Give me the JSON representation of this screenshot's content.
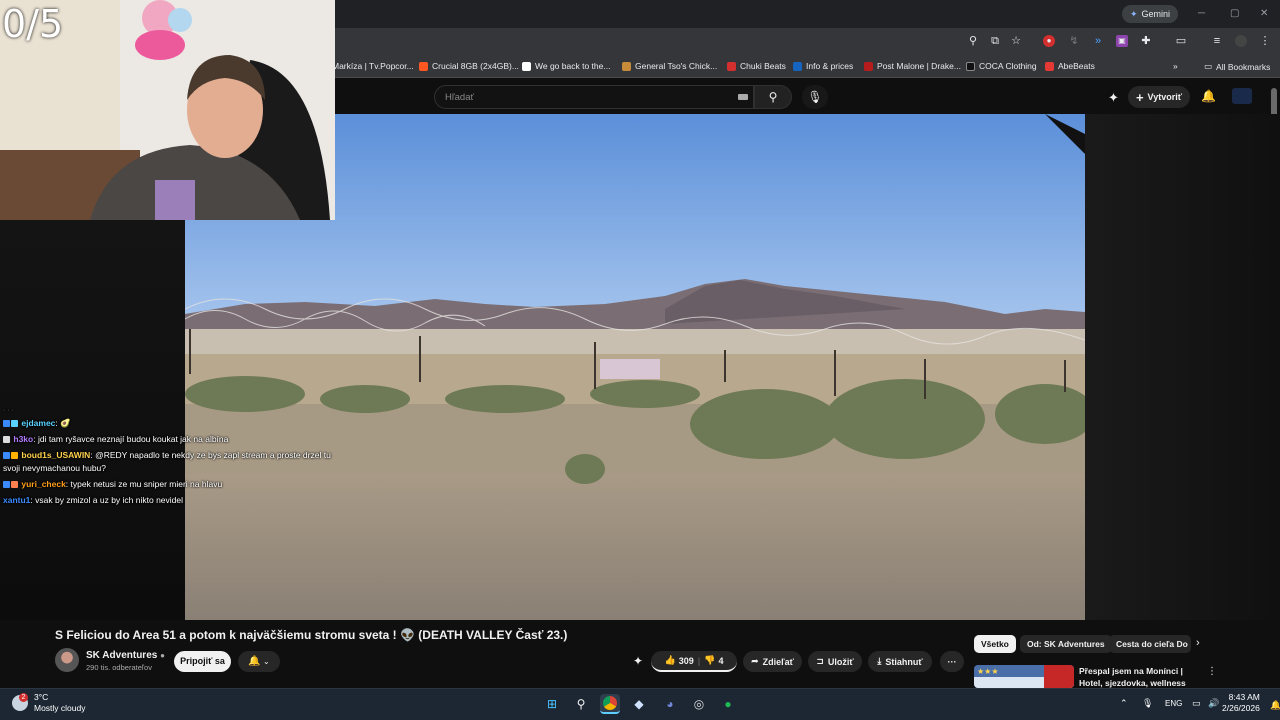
{
  "stream_overlay": {
    "score": "0/5"
  },
  "browser": {
    "gemini_label": "Gemini",
    "bookmarks": [
      {
        "label": "Markíza | Tv.Popcor...",
        "color": "#e53935"
      },
      {
        "label": "Crucial 8GB (2x4GB)...",
        "color": "#ff5722"
      },
      {
        "label": "We go back to the...",
        "color": "#ffffff"
      },
      {
        "label": "General Tso's Chick...",
        "color": "#c78b3a"
      },
      {
        "label": "Chuki Beats",
        "color": "#d32f2f"
      },
      {
        "label": "Info & prices",
        "color": "#1565c0"
      },
      {
        "label": "Post Malone | Drake...",
        "color": "#b71c1c"
      },
      {
        "label": "COCA Clothing",
        "color": "#111111"
      },
      {
        "label": "AbeBeats",
        "color": "#e53935"
      }
    ],
    "all_bookmarks": "All Bookmarks"
  },
  "youtube": {
    "search_placeholder": "Hľadať",
    "create_label": "Vytvoriť",
    "video_title": "S Feliciou do Area 51 a potom k najväčšiemu stromu sveta ! 👽 (DEATH VALLEY Časť 23.)",
    "channel_name": "SK Adventures",
    "subscribers": "290 tis. odberateľov",
    "join_label": "Pripojiť sa",
    "likes": "309",
    "dislikes": "4",
    "share_label": "Zdieľať",
    "save_label": "Uložiť",
    "download_label": "Stiahnuť",
    "chips": [
      "Všetko",
      "Od: SK Adventures",
      "Cesta do cieľa Do"
    ],
    "recommended_title": "Přespal jsem na Monínci | Hotel, sjezdovka, wellness"
  },
  "chat": [
    {
      "user": "ejdamec",
      "text": "🥑",
      "color": "#5ad1ff"
    },
    {
      "user": "h3ko",
      "text": "jdi tam ryšavce neznají budou koukat jak na albína",
      "color": "#b07cff"
    },
    {
      "user": "boud1s_USAWIN",
      "text": "@REDY napadlo te nekdy ze bys zapl stream a proste drzel tu svoji nevymachanou hubu?",
      "color": "#ffd24d"
    },
    {
      "user": "yuri_check",
      "text": "typek netusi ze mu sniper mieri na hlavu",
      "color": "#ff9f1a"
    },
    {
      "user": "xantu1",
      "text": "vsak by zmizol a uz by ich nikto nevidel",
      "color": "#3b8bff"
    }
  ],
  "taskbar": {
    "weather_temp": "3°C",
    "weather_desc": "Mostly cloudy",
    "weather_badge": "2",
    "lang": "ENG",
    "time": "8:43 AM",
    "date": "2/26/2026"
  }
}
